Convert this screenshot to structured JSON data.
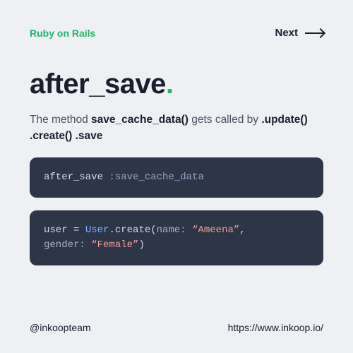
{
  "header": {
    "category": "Ruby on Rails",
    "next_label": "Next"
  },
  "title": {
    "text": "after_save",
    "dot": "."
  },
  "description": {
    "prefix": "The method ",
    "method_bold": "save_cache_data()",
    "middle": " gets called by ",
    "callbacks_bold": ".update() .create() .save"
  },
  "code1": {
    "callback": "after_save",
    "symbol": ":save_cache_data"
  },
  "code2": {
    "var": "user",
    "eq": " = ",
    "class": "User",
    "method": ".create(",
    "key1": "name:",
    "sp": " ",
    "val1": "“Ameena”",
    "comma": ", ",
    "key2": "gender:",
    "val2": "“Female”",
    "close": ")"
  },
  "footer": {
    "handle": "@inkoopteam",
    "url": "https://www.inkoop.io/"
  }
}
